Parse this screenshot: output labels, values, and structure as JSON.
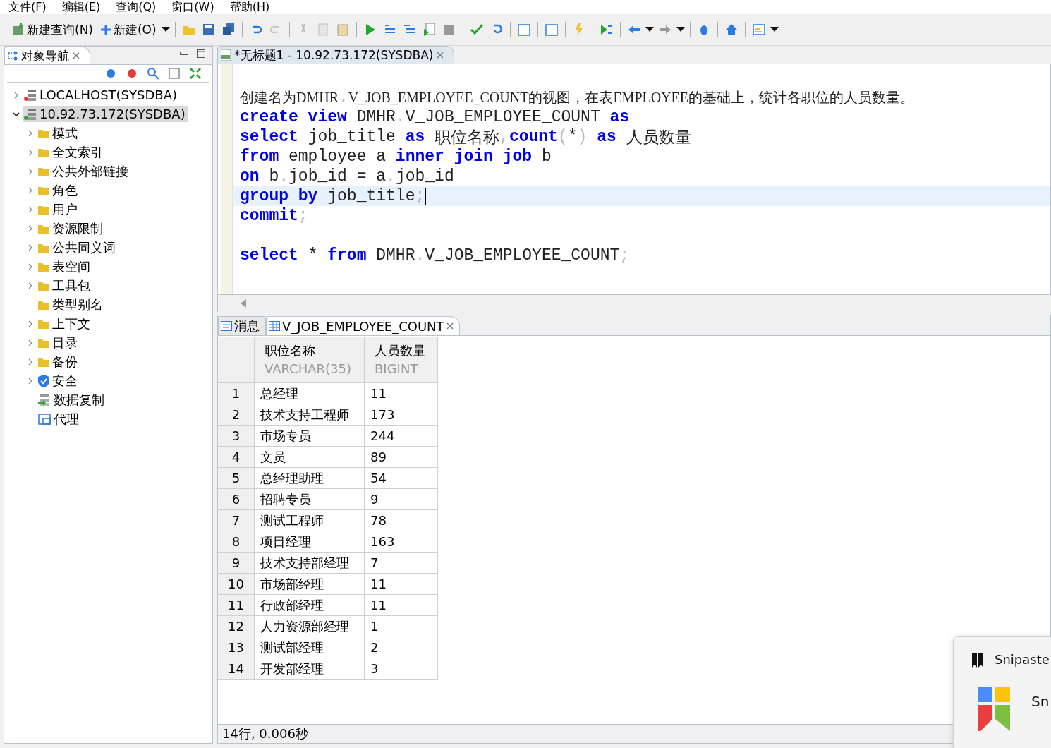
{
  "menu": [
    "文件(F)",
    "编辑(E)",
    "查询(Q)",
    "窗口(W)",
    "帮助(H)"
  ],
  "toolbar": {
    "new_query": "新建查询(N)",
    "new": "新建(O)"
  },
  "navigator": {
    "title": "对象导航",
    "tree": [
      {
        "label": "LOCALHOST(SYSDBA)",
        "kind": "server",
        "color": "#e03c3c",
        "expandable": true,
        "expanded": false,
        "selected": false
      },
      {
        "label": "10.92.73.172(SYSDBA)",
        "kind": "server",
        "color": "#2fa83a",
        "expandable": true,
        "expanded": true,
        "selected": true,
        "children": [
          {
            "label": "模式",
            "kind": "folder",
            "expandable": true,
            "selected": false
          },
          {
            "label": "全文索引",
            "kind": "folder",
            "expandable": true,
            "selected": false
          },
          {
            "label": "公共外部链接",
            "kind": "folder",
            "expandable": true,
            "selected": false
          },
          {
            "label": "角色",
            "kind": "folder",
            "expandable": true,
            "selected": false
          },
          {
            "label": "用户",
            "kind": "folder",
            "expandable": true,
            "selected": false
          },
          {
            "label": "资源限制",
            "kind": "folder",
            "expandable": true,
            "selected": false
          },
          {
            "label": "公共同义词",
            "kind": "folder",
            "expandable": true,
            "selected": false
          },
          {
            "label": "表空间",
            "kind": "folder",
            "expandable": true,
            "selected": false
          },
          {
            "label": "工具包",
            "kind": "folder",
            "expandable": true,
            "selected": false
          },
          {
            "label": "类型别名",
            "kind": "folder",
            "expandable": false,
            "selected": false
          },
          {
            "label": "上下文",
            "kind": "folder",
            "expandable": true,
            "selected": false
          },
          {
            "label": "目录",
            "kind": "folder",
            "expandable": true,
            "selected": false
          },
          {
            "label": "备份",
            "kind": "folder",
            "expandable": true,
            "selected": false
          },
          {
            "label": "安全",
            "kind": "shield",
            "expandable": true,
            "selected": false
          },
          {
            "label": "数据复制",
            "kind": "replication",
            "expandable": false,
            "selected": false
          },
          {
            "label": "代理",
            "kind": "agent",
            "expandable": false,
            "selected": false
          }
        ]
      }
    ]
  },
  "editor": {
    "tab": "*无标题1 - 10.92.73.172(SYSDBA)",
    "lines": [
      {
        "current": false
      },
      {
        "current": false,
        "tokens": [
          {
            "kind": "comment",
            "text": "创建名为DMHR"
          },
          {
            "kind": "punct",
            "text": "."
          },
          {
            "kind": "comment",
            "text": "V_JOB_EMPLOYEE_COUNT的视图，在表EMPLOYEE的基础上，统计各职位的人员数量。"
          }
        ]
      },
      {
        "current": false,
        "tokens": [
          {
            "kind": "keyword",
            "text": "create view "
          },
          {
            "kind": "ident",
            "text": "DMHR"
          },
          {
            "kind": "punct",
            "text": "."
          },
          {
            "kind": "ident",
            "text": "V_JOB_EMPLOYEE_COUNT "
          },
          {
            "kind": "keyword",
            "text": "as"
          }
        ]
      },
      {
        "current": false,
        "tokens": [
          {
            "kind": "keyword",
            "text": "select "
          },
          {
            "kind": "ident",
            "text": "job_title "
          },
          {
            "kind": "keyword",
            "text": "as "
          },
          {
            "kind": "ident",
            "text": "职位名称"
          },
          {
            "kind": "punct",
            "text": ","
          },
          {
            "kind": "keyword",
            "text": "count"
          },
          {
            "kind": "punct",
            "text": "("
          },
          {
            "kind": "ident",
            "text": "*"
          },
          {
            "kind": "punct",
            "text": ") "
          },
          {
            "kind": "keyword",
            "text": "as "
          },
          {
            "kind": "ident",
            "text": "人员数量"
          }
        ]
      },
      {
        "current": false,
        "tokens": [
          {
            "kind": "keyword",
            "text": "from "
          },
          {
            "kind": "ident",
            "text": "employee a "
          },
          {
            "kind": "keyword",
            "text": "inner join job "
          },
          {
            "kind": "ident",
            "text": "b"
          }
        ]
      },
      {
        "current": false,
        "tokens": [
          {
            "kind": "keyword",
            "text": "on "
          },
          {
            "kind": "ident",
            "text": "b"
          },
          {
            "kind": "punct",
            "text": "."
          },
          {
            "kind": "ident",
            "text": "job_id = a"
          },
          {
            "kind": "punct",
            "text": "."
          },
          {
            "kind": "ident",
            "text": "job_id"
          }
        ]
      },
      {
        "current": true,
        "tokens": [
          {
            "kind": "keyword",
            "text": "group by "
          },
          {
            "kind": "ident",
            "text": "job_title"
          },
          {
            "kind": "punct",
            "text": ";"
          }
        ]
      },
      {
        "current": false,
        "tokens": [
          {
            "kind": "keyword",
            "text": "commit"
          },
          {
            "kind": "punct",
            "text": ";"
          }
        ]
      },
      {
        "current": false
      },
      {
        "current": false,
        "tokens": [
          {
            "kind": "keyword",
            "text": "select "
          },
          {
            "kind": "ident",
            "text": "* "
          },
          {
            "kind": "keyword",
            "text": "from "
          },
          {
            "kind": "ident",
            "text": "DMHR"
          },
          {
            "kind": "punct",
            "text": "."
          },
          {
            "kind": "ident",
            "text": "V_JOB_EMPLOYEE_COUNT"
          },
          {
            "kind": "punct",
            "text": ";"
          }
        ]
      }
    ]
  },
  "results": {
    "tabs": [
      {
        "label": "消息",
        "kind": "message",
        "selected": false
      },
      {
        "label": "V_JOB_EMPLOYEE_COUNT",
        "kind": "table",
        "selected": true
      }
    ],
    "columns": [
      {
        "name": "职位名称",
        "type": "VARCHAR(35)"
      },
      {
        "name": "人员数量",
        "type": "BIGINT"
      }
    ],
    "rows": [
      {
        "number": "1",
        "cells": [
          "总经理",
          "11"
        ]
      },
      {
        "number": "2",
        "cells": [
          "技术支持工程师",
          "173"
        ]
      },
      {
        "number": "3",
        "cells": [
          "市场专员",
          "244"
        ]
      },
      {
        "number": "4",
        "cells": [
          "文员",
          "89"
        ]
      },
      {
        "number": "5",
        "cells": [
          "总经理助理",
          "54"
        ]
      },
      {
        "number": "6",
        "cells": [
          "招聘专员",
          "9"
        ]
      },
      {
        "number": "7",
        "cells": [
          "测试工程师",
          "78"
        ]
      },
      {
        "number": "8",
        "cells": [
          "项目经理",
          "163"
        ]
      },
      {
        "number": "9",
        "cells": [
          "技术支持部经理",
          "7"
        ]
      },
      {
        "number": "10",
        "cells": [
          "市场部经理",
          "11"
        ]
      },
      {
        "number": "11",
        "cells": [
          "行政部经理",
          "11"
        ]
      },
      {
        "number": "12",
        "cells": [
          "人力资源部经理",
          "1"
        ]
      },
      {
        "number": "13",
        "cells": [
          "测试部经理",
          "2"
        ]
      },
      {
        "number": "14",
        "cells": [
          "开发部经理",
          "3"
        ]
      }
    ]
  },
  "status_bar": "14行, 0.006秒",
  "notification": {
    "title": "Snipaste",
    "text": "Sn"
  }
}
